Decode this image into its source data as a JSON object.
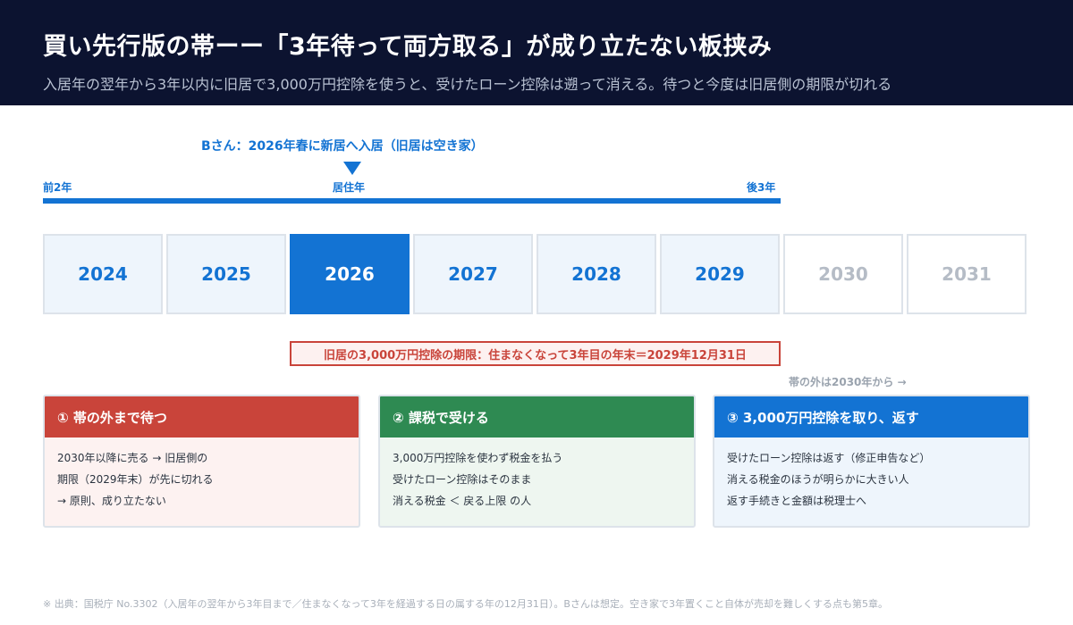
{
  "header": {
    "title": "買い先行版の帯ーー「3年待って両方取る」が成り立たない板挟み",
    "subtitle": "入居年の翌年から3年以内に旧居で3,000万円控除を使うと、受けたローン控除は遡って消える。待つと今度は旧居側の期限が切れる"
  },
  "timeline": {
    "person_label": "Bさん：2026年春に新居へ入居（旧居は空き家）",
    "label_before": "前2年",
    "label_live": "居住年",
    "label_after": "後3年",
    "bar_color": "#1373d3"
  },
  "years": [
    {
      "label": "2024",
      "state": "in"
    },
    {
      "label": "2025",
      "state": "in"
    },
    {
      "label": "2026",
      "state": "active"
    },
    {
      "label": "2027",
      "state": "in"
    },
    {
      "label": "2028",
      "state": "in"
    },
    {
      "label": "2029",
      "state": "in"
    },
    {
      "label": "2030",
      "state": "out"
    },
    {
      "label": "2031",
      "state": "out"
    }
  ],
  "deadline": "旧居の3,000万円控除の期限：住まなくなって3年目の年末＝2029年12月31日",
  "outside_note": "帯の外は2030年から →",
  "options": [
    {
      "title": "① 帯の外まで待つ",
      "color": "#c9443a",
      "lines": [
        "2030年以降に売る → 旧居側の",
        "期限（2029年末）が先に切れる",
        "→ 原則、成り立たない"
      ]
    },
    {
      "title": "② 課税で受ける",
      "color": "#2e8a52",
      "lines": [
        "3,000万円控除を使わず税金を払う",
        "受けたローン控除はそのまま",
        "消える税金 ＜ 戻る上限 の人"
      ]
    },
    {
      "title": "③ 3,000万円控除を取り、返す",
      "color": "#1373d3",
      "lines": [
        "受けたローン控除は返す（修正申告など）",
        "消える税金のほうが明らかに大きい人",
        "返す手続きと金額は税理士へ"
      ]
    }
  ],
  "footnote": "※ 出典：国税庁 No.3302（入居年の翌年から3年目まで／住まなくなって3年を経過する日の属する年の12月31日）。Bさんは想定。空き家で3年置くこと自体が売却を難しくする点も第5章。"
}
